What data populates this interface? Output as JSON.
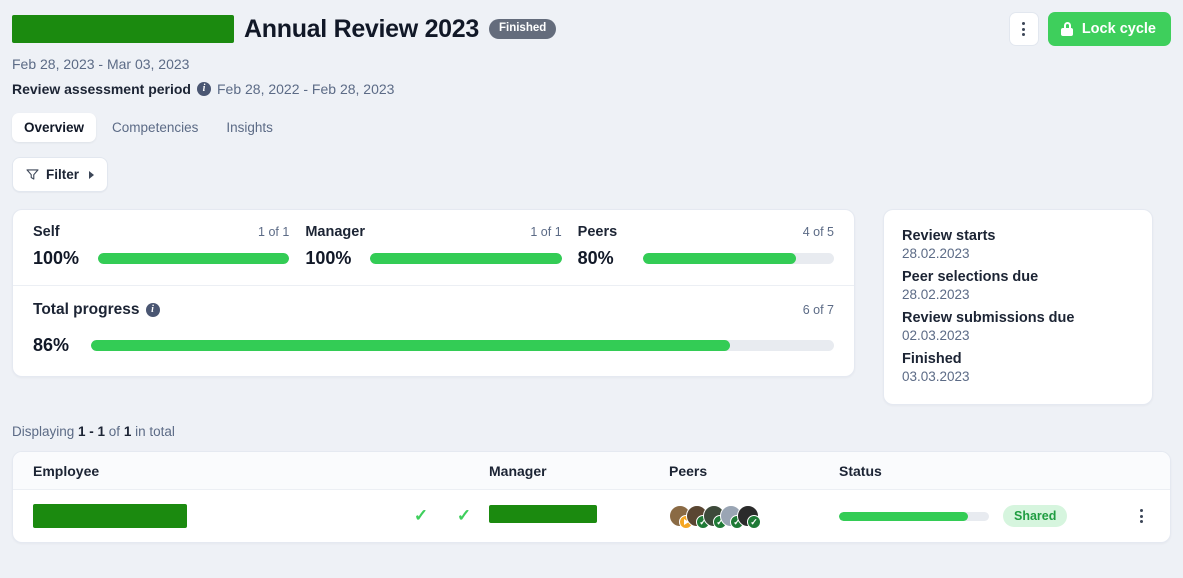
{
  "header": {
    "redacted_name": "",
    "title": "Annual Review 2023",
    "status_badge": "Finished",
    "kebab_icon": "kebab-menu-icon",
    "lock_button": "Lock cycle",
    "lock_icon": "lock-icon"
  },
  "meta": {
    "cycle_dates": "Feb 28, 2023 - Mar 03, 2023",
    "period_label": "Review assessment period",
    "period_info_icon": "info-icon",
    "period_value": "Feb 28, 2022 - Feb 28, 2023"
  },
  "tabs": [
    {
      "label": "Overview",
      "active": true
    },
    {
      "label": "Competencies",
      "active": false
    },
    {
      "label": "Insights",
      "active": false
    }
  ],
  "filter": {
    "label": "Filter",
    "icon": "funnel-icon",
    "caret": "caret-right-icon"
  },
  "progress": {
    "columns": [
      {
        "label": "Self",
        "count": "1 of 1",
        "percent": "100%",
        "value": 100
      },
      {
        "label": "Manager",
        "count": "1 of 1",
        "percent": "100%",
        "value": 100
      },
      {
        "label": "Peers",
        "count": "4 of 5",
        "percent": "80%",
        "value": 80
      }
    ],
    "total": {
      "label": "Total progress",
      "info_icon": "info-icon",
      "count": "6 of 7",
      "percent": "86%",
      "value": 86
    }
  },
  "dates_card": [
    {
      "term": "Review starts",
      "value": "28.02.2023"
    },
    {
      "term": "Peer selections due",
      "value": "28.02.2023"
    },
    {
      "term": "Review submissions due",
      "value": "02.03.2023"
    },
    {
      "term": "Finished",
      "value": "03.03.2023"
    }
  ],
  "displaying": {
    "prefix": "Displaying ",
    "range": "1 - 1",
    "middle": " of ",
    "total": "1",
    "suffix": " in total"
  },
  "table": {
    "headers": [
      "Employee",
      "Manager",
      "Peers",
      "Status"
    ],
    "row": {
      "employee_redacted": "",
      "self_check": "✓",
      "manager_check": "✓",
      "manager_redacted": "",
      "peers": [
        {
          "badge": "pending",
          "glyph": "play-icon",
          "avatar_color": "#8a6a44"
        },
        {
          "badge": "done",
          "glyph": "✓",
          "avatar_color": "#5a4632"
        },
        {
          "badge": "done",
          "glyph": "✓",
          "avatar_color": "#3d4a3a"
        },
        {
          "badge": "done",
          "glyph": "✓",
          "avatar_color": "#9aa5b4"
        },
        {
          "badge": "done",
          "glyph": "✓",
          "avatar_color": "#2b2b2b"
        }
      ],
      "progress_percent": 86,
      "status_label": "Shared",
      "menu_icon": "kebab-menu-icon"
    }
  },
  "colors": {
    "page_bg": "#eef1f6",
    "green": "#33cc55",
    "lock_green": "#3ecf5c",
    "redaction_green": "#1b8a0f",
    "badge_gray": "#646c7c",
    "shared_bg": "#d6f5de",
    "shared_text": "#1f9d41"
  }
}
